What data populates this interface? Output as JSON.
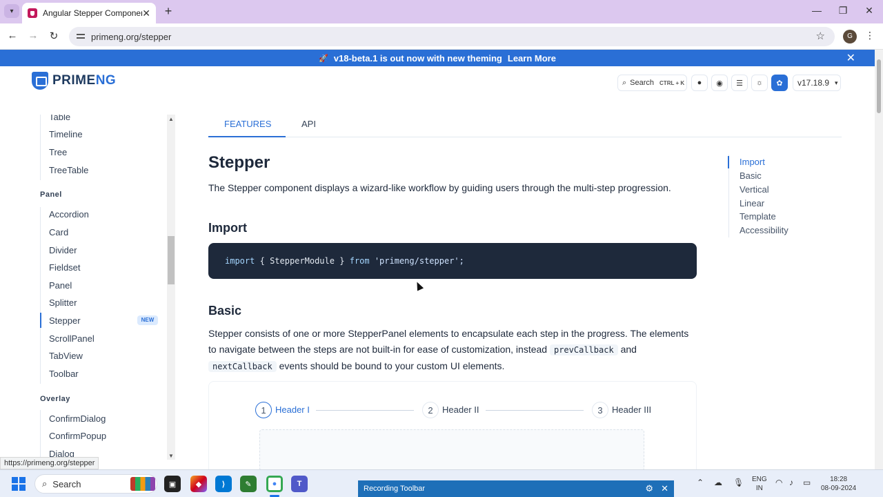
{
  "browser": {
    "tab_title": "Angular Stepper Component",
    "url": "primeng.org/stepper",
    "profile_initial": "G",
    "status_url": "https://primeng.org/stepper"
  },
  "banner": {
    "text": "v18-beta.1 is out now with new theming",
    "link": "Learn More"
  },
  "header": {
    "logo_prime": "PRIME",
    "logo_ng": "NG",
    "search_label": "Search",
    "search_shortcut": "CTRL + K",
    "version": "v17.18.9"
  },
  "sidebar": {
    "items_top": [
      "Table",
      "Timeline",
      "Tree",
      "TreeTable"
    ],
    "group_panel": "Panel",
    "panel_items": [
      "Accordion",
      "Card",
      "Divider",
      "Fieldset",
      "Panel",
      "Splitter",
      "Stepper",
      "ScrollPanel",
      "TabView",
      "Toolbar"
    ],
    "new_badge": "NEW",
    "group_overlay": "Overlay",
    "overlay_items": [
      "ConfirmDialog",
      "ConfirmPopup",
      "Dialog"
    ]
  },
  "content": {
    "tabs": [
      "FEATURES",
      "API"
    ],
    "title": "Stepper",
    "description": "The Stepper component displays a wizard-like workflow by guiding users through the multi-step progression.",
    "import_heading": "Import",
    "code": {
      "kw_import": "import",
      "brace_open": "{",
      "module": "StepperModule",
      "brace_close": "}",
      "kw_from": "from",
      "path": "'primeng/stepper';"
    },
    "basic_heading": "Basic",
    "basic_p1": "Stepper consists of one or more StepperPanel elements to encapsulate each step in the progress. The elements to navigate between the steps are not built-in for ease of customization, instead",
    "chip_prev": "prevCallback",
    "and": "and",
    "chip_next": "nextCallback",
    "basic_p2": "events should be bound to your custom UI elements.",
    "steps": [
      {
        "num": "1",
        "label": "Header I"
      },
      {
        "num": "2",
        "label": "Header II"
      },
      {
        "num": "3",
        "label": "Header III"
      }
    ]
  },
  "toc": [
    "Import",
    "Basic",
    "Vertical",
    "Linear",
    "Template",
    "Accessibility"
  ],
  "taskbar": {
    "search": "Search",
    "recording_toolbar": "Recording Toolbar",
    "lang_1": "ENG",
    "lang_2": "IN",
    "time": "18:28",
    "date": "08-09-2024"
  },
  "colors": {
    "accent": "#2a6fd6",
    "code_bg": "#1e293b",
    "tab_bar": "#dcc8ef"
  }
}
